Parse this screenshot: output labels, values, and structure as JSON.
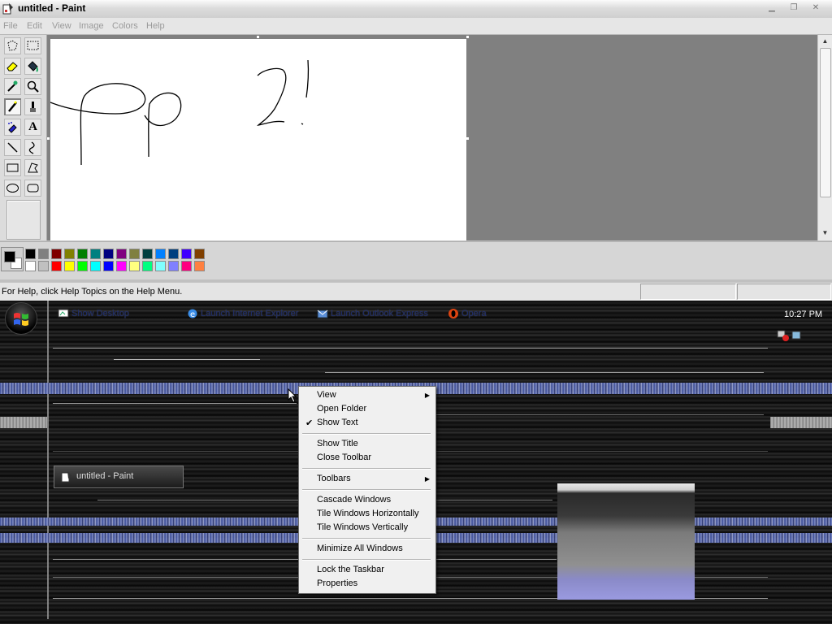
{
  "window": {
    "title": "untitled - Paint",
    "controls": [
      "minimize",
      "maximize",
      "close"
    ]
  },
  "menu": [
    "File",
    "Edit",
    "View",
    "Image",
    "Colors",
    "Help"
  ],
  "tools": [
    {
      "name": "free-form-select-icon"
    },
    {
      "name": "select-icon"
    },
    {
      "name": "eraser-icon"
    },
    {
      "name": "fill-icon"
    },
    {
      "name": "pick-color-icon"
    },
    {
      "name": "magnifier-icon"
    },
    {
      "name": "pencil-icon",
      "active": true
    },
    {
      "name": "brush-icon"
    },
    {
      "name": "airbrush-icon"
    },
    {
      "name": "text-icon",
      "glyph": "A"
    },
    {
      "name": "line-icon"
    },
    {
      "name": "curve-icon"
    },
    {
      "name": "rectangle-icon"
    },
    {
      "name": "polygon-icon"
    },
    {
      "name": "ellipse-icon"
    },
    {
      "name": "rounded-rectangle-icon"
    }
  ],
  "palette": {
    "foreground": "#000000",
    "background": "#ffffff",
    "row1": [
      "#000000",
      "#808080",
      "#800000",
      "#808000",
      "#008000",
      "#008080",
      "#000080",
      "#800080",
      "#808040",
      "#004040",
      "#0080ff",
      "#004080",
      "#4000ff",
      "#804000"
    ],
    "row2": [
      "#ffffff",
      "#c0c0c0",
      "#ff0000",
      "#ffff00",
      "#00ff00",
      "#00ffff",
      "#0000ff",
      "#ff00ff",
      "#ffff80",
      "#00ff80",
      "#80ffff",
      "#8080ff",
      "#ff0080",
      "#ff8040"
    ]
  },
  "status": {
    "help_text": "For Help, click Help Topics on the Help Menu."
  },
  "taskbar": {
    "quick_launch": [
      {
        "label": "Show Desktop",
        "icon": "show-desktop-icon"
      },
      {
        "label": "Launch Internet Explorer",
        "icon": "internet-explorer-icon"
      },
      {
        "label": "Launch Outlook Express",
        "icon": "outlook-express-icon"
      },
      {
        "label": "Opera",
        "icon": "opera-icon"
      }
    ],
    "clock": "10:27 PM",
    "task_button": "untitled - Paint"
  },
  "context_menu": {
    "items": [
      {
        "label": "View",
        "submenu": true
      },
      {
        "label": "Open Folder"
      },
      {
        "label": "Show Text",
        "checked": true
      },
      {
        "label": "Show Title"
      },
      {
        "label": "Close Toolbar"
      },
      {
        "label": "Toolbars",
        "submenu": true
      },
      {
        "label": "Cascade Windows"
      },
      {
        "label": "Tile Windows Horizontally"
      },
      {
        "label": "Tile Windows Vertically"
      },
      {
        "label": "Minimize All Windows"
      },
      {
        "label": "Lock the Taskbar"
      },
      {
        "label": "Properties"
      }
    ]
  }
}
